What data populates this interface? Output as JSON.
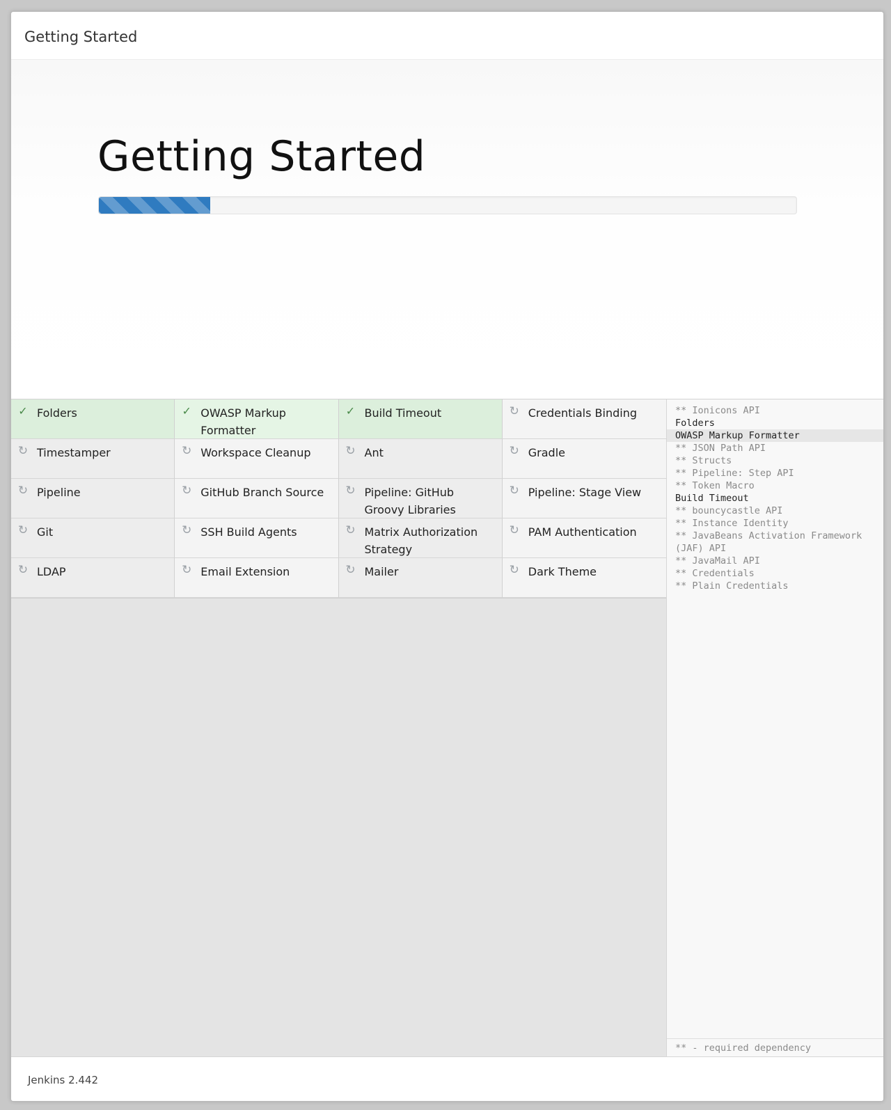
{
  "header": {
    "title": "Getting Started"
  },
  "hero": {
    "title": "Getting Started",
    "progress_percent": 16
  },
  "plugins": [
    {
      "name": "Folders",
      "status": "installed"
    },
    {
      "name": "OWASP Markup Formatter",
      "status": "installed"
    },
    {
      "name": "Build Timeout",
      "status": "installed"
    },
    {
      "name": "Credentials Binding",
      "status": "pending"
    },
    {
      "name": "Timestamper",
      "status": "pending"
    },
    {
      "name": "Workspace Cleanup",
      "status": "pending"
    },
    {
      "name": "Ant",
      "status": "pending"
    },
    {
      "name": "Gradle",
      "status": "pending"
    },
    {
      "name": "Pipeline",
      "status": "pending"
    },
    {
      "name": "GitHub Branch Source",
      "status": "pending"
    },
    {
      "name": "Pipeline: GitHub Groovy Libraries",
      "status": "pending"
    },
    {
      "name": "Pipeline: Stage View",
      "status": "pending"
    },
    {
      "name": "Git",
      "status": "pending"
    },
    {
      "name": "SSH Build Agents",
      "status": "pending"
    },
    {
      "name": "Matrix Authorization Strategy",
      "status": "pending"
    },
    {
      "name": "PAM Authentication",
      "status": "pending"
    },
    {
      "name": "LDAP",
      "status": "pending"
    },
    {
      "name": "Email Extension",
      "status": "pending"
    },
    {
      "name": "Mailer",
      "status": "pending"
    },
    {
      "name": "Dark Theme",
      "status": "pending"
    }
  ],
  "icons": {
    "installed": "check-icon",
    "pending": "refresh-icon"
  },
  "log": {
    "lines": [
      {
        "text": "** Ionicons API",
        "type": "dep"
      },
      {
        "text": "Folders",
        "type": "main"
      },
      {
        "text": "OWASP Markup Formatter",
        "type": "main",
        "highlight": true
      },
      {
        "text": "** JSON Path API",
        "type": "dep"
      },
      {
        "text": "** Structs",
        "type": "dep"
      },
      {
        "text": "** Pipeline: Step API",
        "type": "dep"
      },
      {
        "text": "** Token Macro",
        "type": "dep"
      },
      {
        "text": "Build Timeout",
        "type": "main"
      },
      {
        "text": "** bouncycastle API",
        "type": "dep"
      },
      {
        "text": "** Instance Identity",
        "type": "dep"
      },
      {
        "text": "** JavaBeans Activation Framework (JAF) API",
        "type": "dep"
      },
      {
        "text": "** JavaMail API",
        "type": "dep"
      },
      {
        "text": "** Credentials",
        "type": "dep"
      },
      {
        "text": "** Plain Credentials",
        "type": "dep"
      }
    ],
    "footnote": "** - required dependency"
  },
  "footer": {
    "version": "Jenkins 2.442"
  }
}
